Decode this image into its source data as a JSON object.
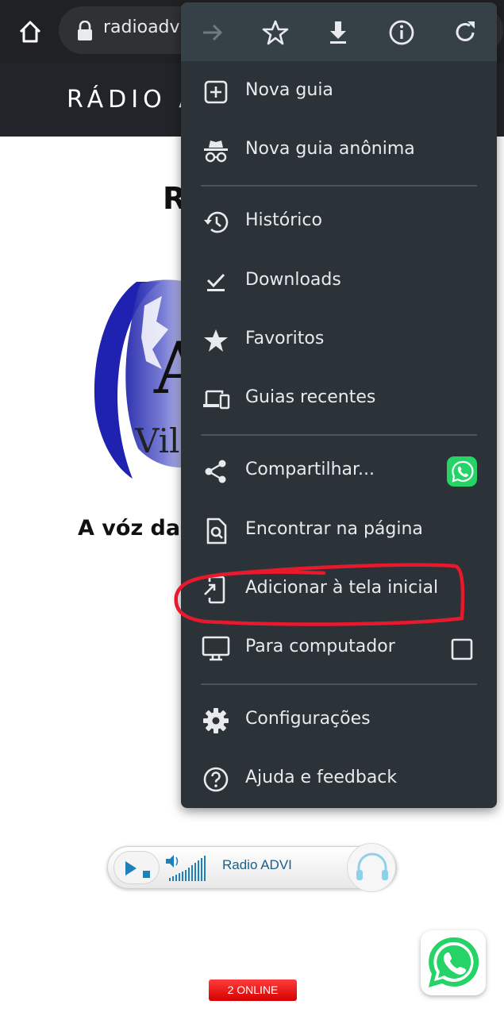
{
  "browser": {
    "url": "radioadvi"
  },
  "site": {
    "title": "RÁDIO A",
    "heading": "R",
    "logo_text": "A",
    "logo_subtext": "Vila",
    "tagline": "A vóz da"
  },
  "menu": {
    "items": [
      {
        "label": "Nova guia",
        "icon": "plus-box-icon"
      },
      {
        "label": "Nova guia anônima",
        "icon": "incognito-icon"
      },
      {
        "label": "Histórico",
        "icon": "history-icon"
      },
      {
        "label": "Downloads",
        "icon": "download-check-icon"
      },
      {
        "label": "Favoritos",
        "icon": "star-filled-icon"
      },
      {
        "label": "Guias recentes",
        "icon": "devices-icon"
      },
      {
        "label": "Compartilhar...",
        "icon": "share-icon"
      },
      {
        "label": "Encontrar na página",
        "icon": "find-in-page-icon"
      },
      {
        "label": "Adicionar à tela inicial",
        "icon": "add-to-home-icon"
      },
      {
        "label": "Para computador",
        "icon": "desktop-icon"
      },
      {
        "label": "Configurações",
        "icon": "gear-icon"
      },
      {
        "label": "Ajuda e feedback",
        "icon": "help-icon"
      }
    ],
    "desktop_site_checked": false
  },
  "player": {
    "station": "Radio ADVI"
  },
  "online_badge": "2 ONLINE",
  "colors": {
    "menu_bg": "#2b3238",
    "menu_toolbar_bg": "#354047",
    "annotation": "#e8192c",
    "whatsapp": "#25d366"
  }
}
